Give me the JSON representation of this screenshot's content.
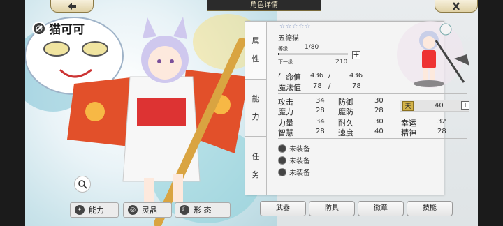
{
  "header": {
    "title": "角色详情"
  },
  "character": {
    "name": "猫可可"
  },
  "bottom_left": {
    "buttons": [
      "能力",
      "灵晶",
      "形 态"
    ]
  },
  "side_tabs": [
    {
      "chars": [
        "属",
        "性"
      ]
    },
    {
      "chars": [
        "能",
        "力"
      ]
    },
    {
      "chars": [
        "任",
        "务"
      ]
    }
  ],
  "info": {
    "stars": "☆☆☆☆☆",
    "class_name": "五德猫",
    "level_label": "等级",
    "level_value": "1/80",
    "level_progress": 0.0125,
    "next_label": "下一级",
    "next_value": "210",
    "hp_label": "生命值",
    "hp_value": "436",
    "hp_sep": "/",
    "hp_max": "436",
    "mp_label": "魔法值",
    "mp_value": "78",
    "mp_sep": "/",
    "mp_max": "78"
  },
  "stats": {
    "atk_label": "攻击",
    "atk": "34",
    "def_label": "防御",
    "def": "30",
    "matk_label": "魔力",
    "matk": "28",
    "mdef_label": "魔防",
    "mdef": "28",
    "str_label": "力量",
    "str": "34",
    "end_label": "耐久",
    "end": "30",
    "luck_label": "幸运",
    "luck": "32",
    "int_label": "智慧",
    "int": "28",
    "spd_label": "速度",
    "spd": "40",
    "spi_label": "精神",
    "spi": "28"
  },
  "bonus": {
    "badge": "天",
    "value": "40"
  },
  "equipment": [
    "未装备",
    "未装备",
    "未装备"
  ],
  "bottom_tabs": [
    "武器",
    "防具",
    "徽章",
    "技能"
  ]
}
